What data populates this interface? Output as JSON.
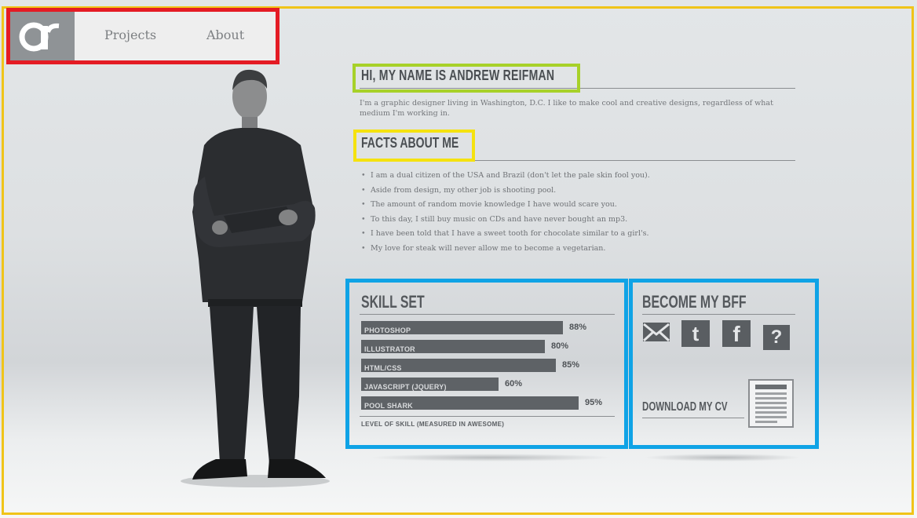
{
  "nav": {
    "logo_alt": "ar",
    "links": [
      {
        "label": "Projects"
      },
      {
        "label": "About"
      }
    ]
  },
  "intro": {
    "heading": "HI, MY NAME IS ANDREW REIFMAN",
    "text": "I'm a graphic designer living in Washington, D.C. I like to make cool and creative designs, regardless of what medium I'm working in."
  },
  "facts": {
    "heading": "FACTS ABOUT ME",
    "items": [
      "I am a dual citizen of the USA and Brazil (don't let the pale skin fool you).",
      "Aside from design, my other job is shooting pool.",
      "The amount of random movie knowledge I have would scare you.",
      "To this day, I still buy music on CDs and have never bought an mp3.",
      "I have been told that I have a sweet tooth for chocolate similar to a girl's.",
      "My love for steak will never allow me to become a vegetarian."
    ]
  },
  "skills": {
    "heading": "SKILL SET",
    "items": [
      {
        "name": "PHOTOSHOP",
        "percent_label": "88%",
        "level": 0.88
      },
      {
        "name": "ILLUSTRATOR",
        "percent_label": "80%",
        "level": 0.8
      },
      {
        "name": "HTML/CSS",
        "percent_label": "85%",
        "level": 0.85
      },
      {
        "name": "JAVASCRIPT (JQUERY)",
        "percent_label": "60%",
        "level": 0.6
      },
      {
        "name": "POOL SHARK",
        "percent_label": "95%",
        "level": 0.95
      }
    ],
    "footnote": "LEVEL OF SKILL (MEASURED IN AWESOME)"
  },
  "bff": {
    "heading": "BECOME MY BFF",
    "icons": [
      "mail-icon",
      "twitter-icon",
      "facebook-icon",
      "formspring-icon"
    ],
    "facebook_glyph": "f",
    "twitter_glyph": "t",
    "question_glyph": "?",
    "cv_label": "DOWNLOAD MY CV"
  }
}
